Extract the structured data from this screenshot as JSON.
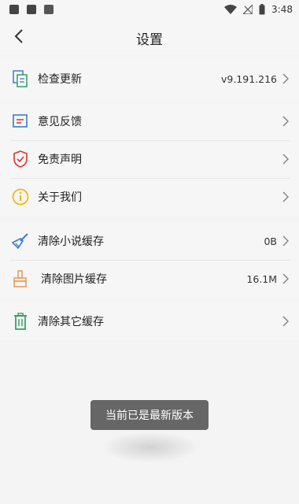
{
  "status_bar": {
    "time": "3:48"
  },
  "header": {
    "title": "设置"
  },
  "section1": [
    {
      "label": "检查更新",
      "value": "v9.191.216",
      "icon": "update-icon"
    }
  ],
  "section2": [
    {
      "label": "意见反馈",
      "value": "",
      "icon": "feedback-icon"
    },
    {
      "label": "免责声明",
      "value": "",
      "icon": "shield-icon"
    },
    {
      "label": "关于我们",
      "value": "",
      "icon": "info-icon"
    }
  ],
  "section3": [
    {
      "label": "清除小说缓存",
      "value": "0B",
      "icon": "broom-icon"
    },
    {
      "label": "清除图片缓存",
      "value": "16.1M",
      "icon": "brush-icon"
    }
  ],
  "section4": [
    {
      "label": "清除其它缓存",
      "value": "",
      "icon": "trash-icon"
    }
  ],
  "toast": {
    "message": "当前已是最新版本"
  },
  "colors": {
    "accent_blue": "#3a7bd5",
    "accent_red": "#e53935",
    "accent_yellow": "#f2b705",
    "accent_green": "#2e9e5b",
    "accent_orange": "#e89a55"
  }
}
